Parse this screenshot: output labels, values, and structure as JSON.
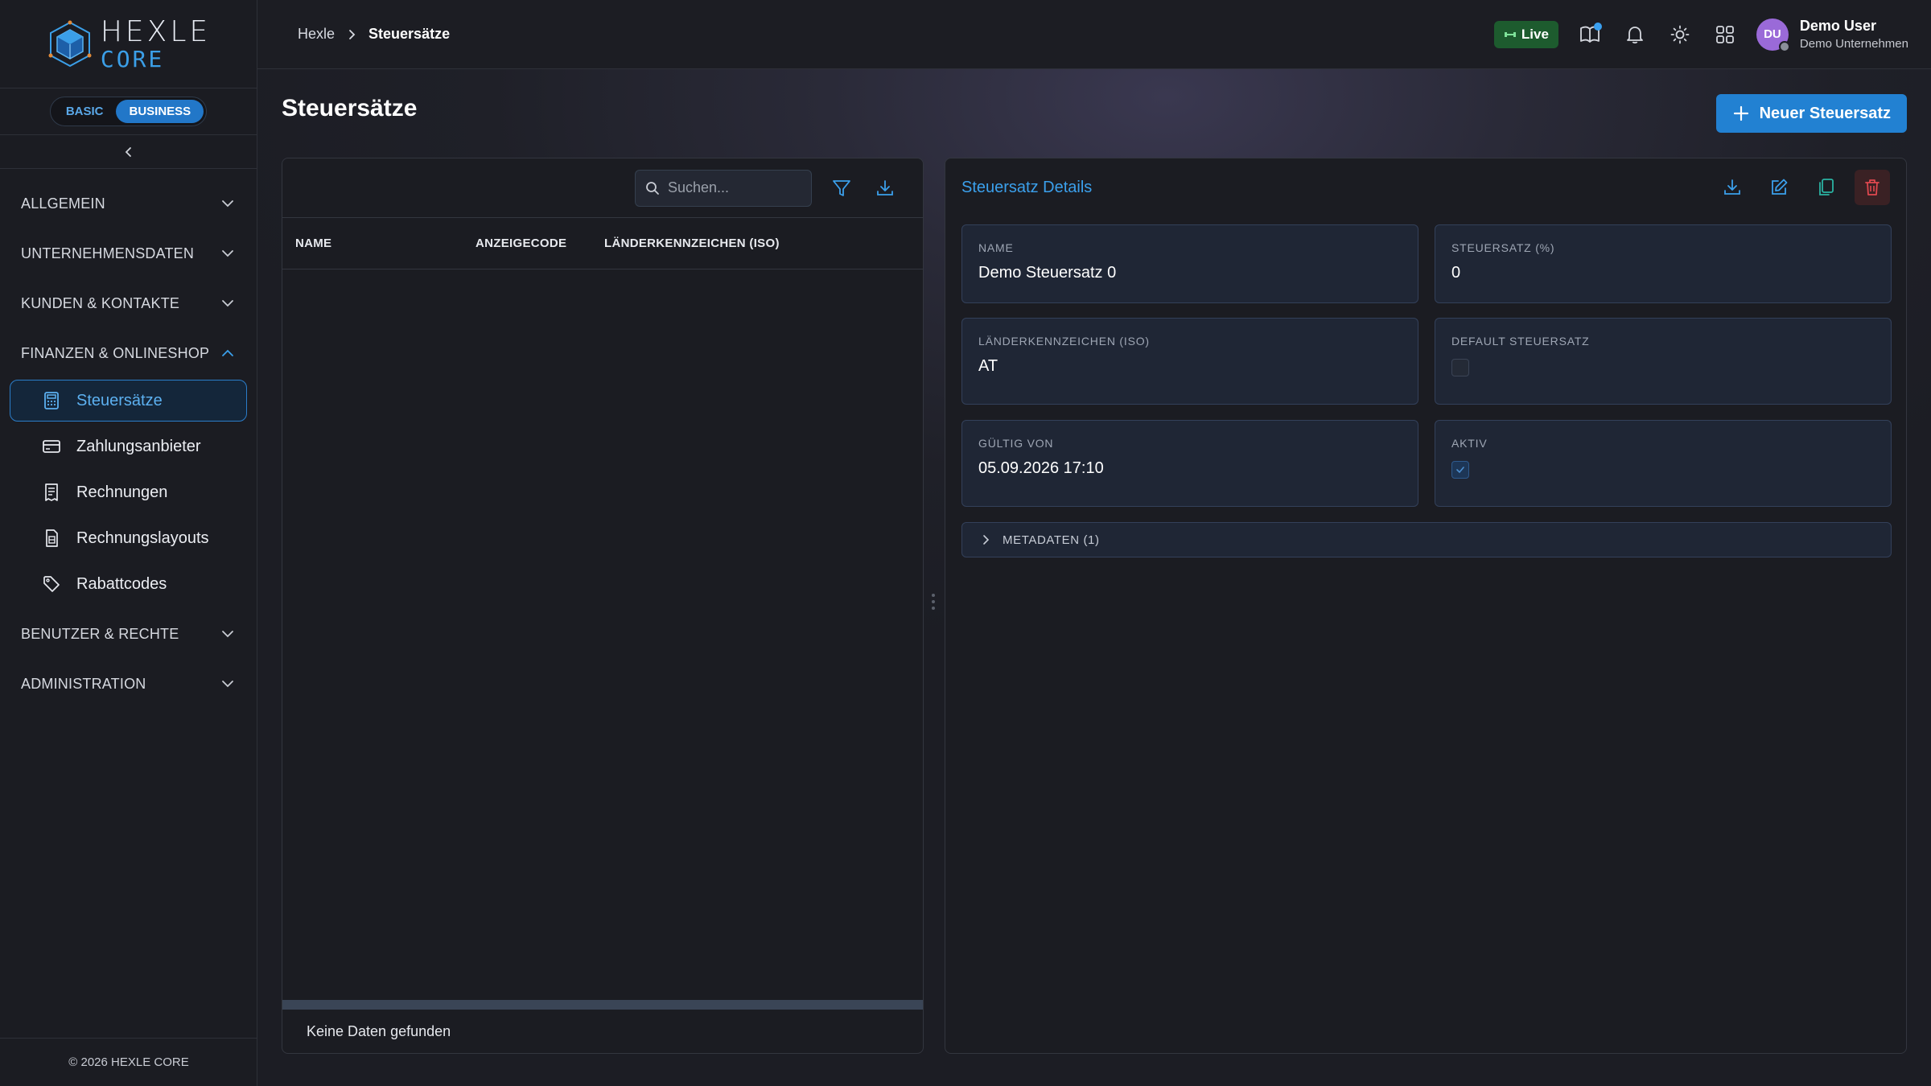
{
  "logo": {
    "line1": "HEXLE",
    "line2": "CORE"
  },
  "plan": {
    "options": [
      "BASIC",
      "BUSINESS"
    ],
    "selected": "BUSINESS"
  },
  "nav": {
    "groups": {
      "allgemein": "ALLGEMEIN",
      "unternehmensdaten": "UNTERNEHMENSDATEN",
      "kunden": "KUNDEN & KONTAKTE",
      "finanzen": "FINANZEN & ONLINESHOP",
      "benutzer": "BENUTZER & RECHTE",
      "administration": "ADMINISTRATION"
    },
    "finanzen_items": [
      {
        "label": "Steuersätze",
        "icon": "calculator-icon",
        "active": true
      },
      {
        "label": "Zahlungsanbieter",
        "icon": "credit-card-icon"
      },
      {
        "label": "Rechnungen",
        "icon": "receipt-icon"
      },
      {
        "label": "Rechnungslayouts",
        "icon": "document-layout-icon"
      },
      {
        "label": "Rabattcodes",
        "icon": "tag-icon"
      }
    ]
  },
  "footer": {
    "copyright": "© 2026 HEXLE CORE"
  },
  "breadcrumb": {
    "root": "Hexle",
    "current": "Steuersätze"
  },
  "topbar": {
    "live_label": "Live",
    "user_initials": "DU",
    "user_name": "Demo User",
    "user_company": "Demo Unternehmen"
  },
  "page": {
    "title": "Steuersätze",
    "new_button": "Neuer Steuersatz"
  },
  "list": {
    "search_placeholder": "Suchen...",
    "columns": [
      "NAME",
      "ANZEIGECODE",
      "LÄNDERKENNZEICHEN (ISO)"
    ],
    "rows": [],
    "empty_text": "Keine Daten gefunden"
  },
  "detail": {
    "title": "Steuersatz Details",
    "fields": {
      "name": {
        "label": "NAME",
        "value": "Demo Steuersatz 0"
      },
      "rate": {
        "label": "STEUERSATZ (%)",
        "value": "0"
      },
      "iso": {
        "label": "LÄNDERKENNZEICHEN (ISO)",
        "value": "AT"
      },
      "default": {
        "label": "DEFAULT STEUERSATZ",
        "checked": false
      },
      "valid_from": {
        "label": "GÜLTIG VON",
        "value": "05.09.2026 17:10"
      },
      "active": {
        "label": "AKTIV",
        "checked": true
      }
    },
    "metadata_label": "METADATEN (1)"
  },
  "colors": {
    "accent": "#2281d2",
    "link": "#3ba0ec",
    "live": "#1d5b2e",
    "delete": "#e0484f",
    "copy": "#2bb3a3"
  }
}
